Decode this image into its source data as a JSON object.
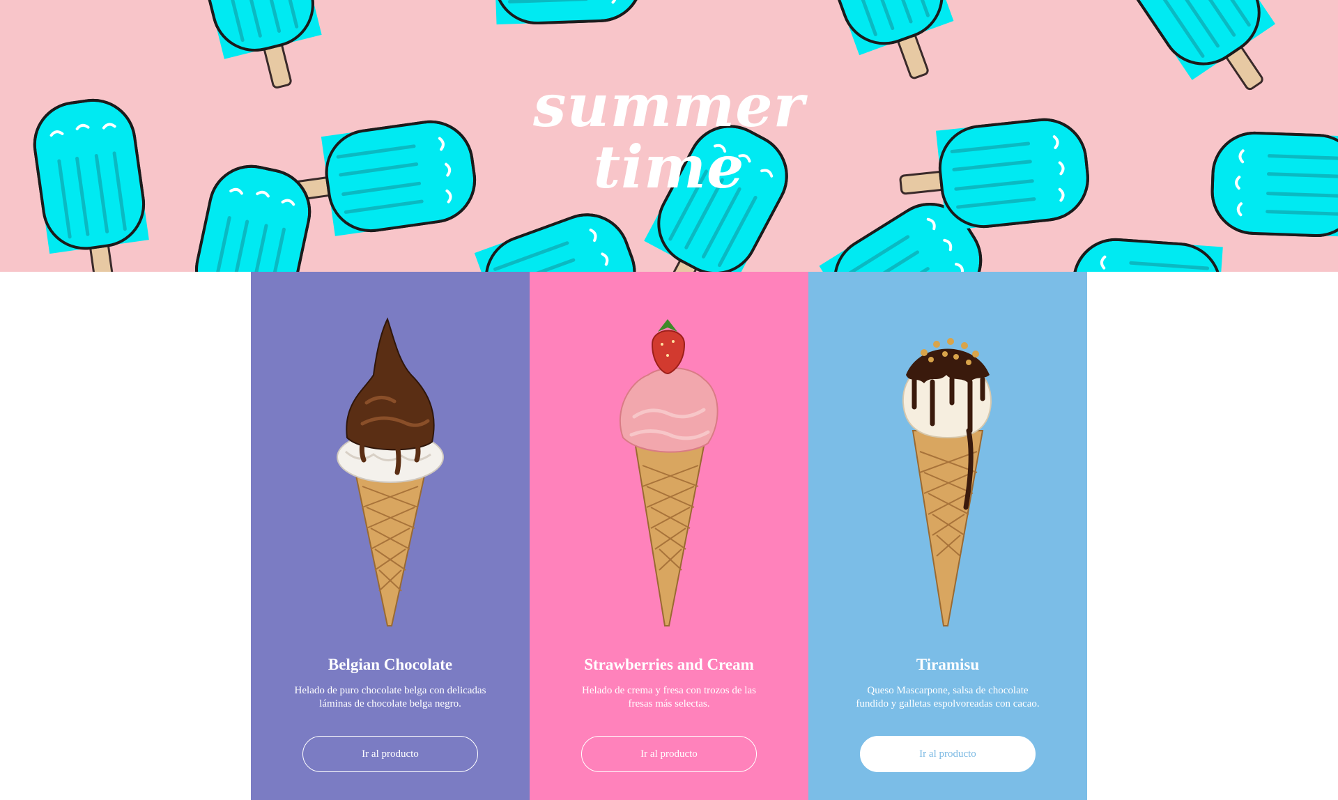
{
  "hero": {
    "title_line1": "summer",
    "title_line2": "time",
    "background_color": "#f8c5c9",
    "pattern_icon": "popsicle-icon",
    "popsicle_color": "#00eaf2"
  },
  "products": [
    {
      "name": "Belgian Chocolate",
      "description": "Helado de puro chocolate belga con delicadas\nláminas de chocolate belga negro.",
      "button_label": "Ir al producto",
      "background_color": "#7b7cc3",
      "illustration": "chocolate-cone-icon"
    },
    {
      "name": "Strawberries and Cream",
      "description": "Helado de crema y fresa con trozos de las\nfresas más selectas.",
      "button_label": "Ir al producto",
      "background_color": "#ff82bb",
      "illustration": "strawberry-cone-icon"
    },
    {
      "name": "Tiramisu",
      "description": "Queso Mascarpone, salsa de chocolate\nfundido y galletas espolvoreadas con cacao.",
      "button_label": "Ir al producto",
      "background_color": "#7bbde7",
      "illustration": "tiramisu-cone-icon"
    }
  ]
}
